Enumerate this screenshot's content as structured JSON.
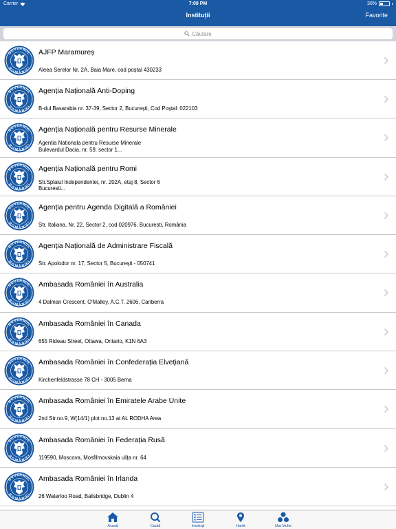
{
  "status": {
    "carrier": "Carrier",
    "time": "7:08 PM",
    "battery": "30%",
    "battery_level": 0.3
  },
  "nav": {
    "title": "Instituții",
    "right_label": "Favorite"
  },
  "search": {
    "placeholder": "Căutare"
  },
  "items": [
    {
      "title": "AJFP Maramureș",
      "address": "Aleea Serelor Nr. 2A, Baia Mare, cod poștal  430233",
      "address2": ""
    },
    {
      "title": "Agenția Națională Anti-Doping",
      "address": "B-dul Basarabia nr. 37-39, Sector 2, București, Cod Poștal: 022103",
      "address2": ""
    },
    {
      "title": "Agenția Națională pentru Resurse Minerale",
      "address": "Agentia Nationala pentru Resurse Minerale",
      "address2": "Bulevardul Dacia, nr. 59, sector 1..."
    },
    {
      "title": "Agenția Națională pentru Romi",
      "address": "Str.Splaiul Independentei, nr. 202A, etaj 8, Sector 6",
      "address2": "Bucuresti..."
    },
    {
      "title": "Agenția pentru Agenda Digitală a României",
      "address": "Str. Italiana, Nr. 22, Sector 2, cod 020976, Bucuresti, România",
      "address2": ""
    },
    {
      "title": "Agenția Națională de Administrare Fiscală",
      "address": "Str. Apolodor nr. 17, Sector 5, București - 050741",
      "address2": ""
    },
    {
      "title": "Ambasada României în Australia",
      "address": "4 Dalman Crescent, O'Malley, A.C.T. 2606, Canberra",
      "address2": ""
    },
    {
      "title": "Ambasada României în Canada",
      "address": "655 Rideau Street, Ottawa, Ontario, K1N 6A3",
      "address2": ""
    },
    {
      "title": "Ambasada României în Confederația Elvețiană",
      "address": "Kirchenfeldstrasse 78 CH - 3005 Berna",
      "address2": ""
    },
    {
      "title": "Ambasada României în Emiratele Arabe Unite",
      "address": "2nd Str.no.9, W(14/1) plot no.13 at AL RODHA Area",
      "address2": ""
    },
    {
      "title": "Ambasada României în Federația Rusă",
      "address": "119590, Moscova, Mosfilmovskaia ulița nr. 64",
      "address2": ""
    },
    {
      "title": "Ambasada României în Irlanda",
      "address": "26 Waterloo Road, Ballsbridge, Dublin 4",
      "address2": ""
    }
  ],
  "logo": {
    "text": "GUVERNUL ROMÂNIEI",
    "color": "#1a5aa5"
  },
  "tabs": [
    {
      "label": "Acasă",
      "icon": "home-icon"
    },
    {
      "label": "Caută",
      "icon": "search-icon"
    },
    {
      "label": "Instituții",
      "icon": "list-icon"
    },
    {
      "label": "Hartă",
      "icon": "map-pin-icon"
    },
    {
      "label": "Mai Multe",
      "icon": "more-icon"
    }
  ],
  "colors": {
    "accent": "#1a5aa5",
    "separator": "#c8c7cc",
    "search_bg": "#d1d5db"
  }
}
